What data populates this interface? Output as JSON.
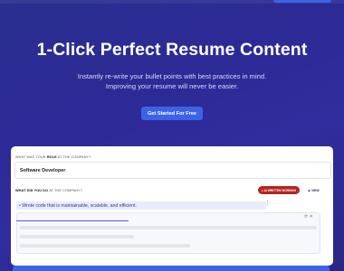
{
  "hero": {
    "title": "1-Click Perfect Resume Content",
    "subtitle_line1": "Instantly re-write your bullet points with best practices in mind.",
    "subtitle_line2": "Improving your resume will never be easier.",
    "cta_label": "Get Started For Free"
  },
  "form": {
    "role_label_prefix": "WHAT WAS YOUR ",
    "role_label_bold": "ROLE",
    "role_label_suffix": " AT THE COMPANY?",
    "role_value": "Software Developer",
    "duty_label_prefix": "WHAT DID YOU DO ",
    "duty_label_suffix": "AT THE COMPANY?",
    "badge_written": "AI WRITTEN WORKING",
    "badge_view": "VIEW",
    "bullet_text": "• Wrote code that is maintainable, scalable, and efficient.",
    "result_controls": "⟳ ✕"
  },
  "colors": {
    "accent": "#3c62e8",
    "badge_red": "#b3261e",
    "highlight": "#e8ecfa"
  },
  "icons": {
    "badge_written_icon": "pin-icon",
    "badge_view_icon": "eye-icon",
    "menu_icon": "more-vertical-icon",
    "refresh_icon": "refresh-icon",
    "close_icon": "close-icon"
  }
}
